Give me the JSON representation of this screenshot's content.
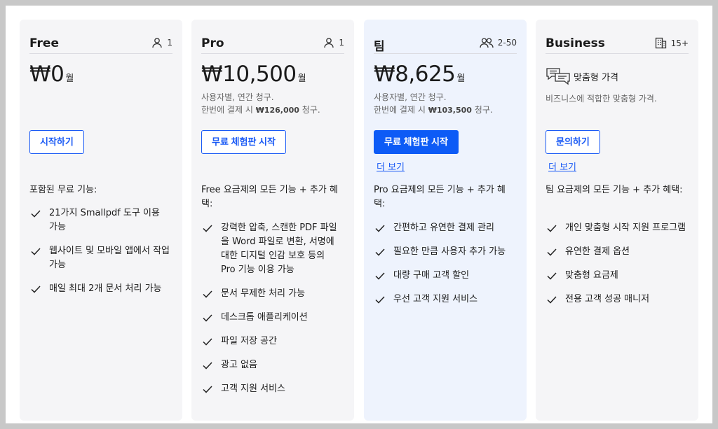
{
  "plans": [
    {
      "name": "Free",
      "users": "1",
      "price": "₩0",
      "per": "월",
      "cta": "시작하기",
      "features_title": "포함된 무료 기능:",
      "features": [
        "21가지 Smallpdf 도구 이용 가능",
        "웹사이트 및 모바일 앱에서 작업 가능",
        "매일 최대 2개 문서 처리 가능"
      ]
    },
    {
      "name": "Pro",
      "users": "1",
      "price": "₩10,500",
      "per": "월",
      "billing_line1": "사용자별, 연간 청구.",
      "billing_line2_pre": "한번에 결제 시",
      "billing_amount": "₩126,000",
      "billing_line2_post": "청구.",
      "cta": "무료 체험판 시작",
      "features_title": "Free 요금제의 모든 기능 + 추가 혜택:",
      "features": [
        "강력한 압축, 스캔한 PDF 파일을 Word 파일로 변환, 서명에 대한 디지털 인감 보호 등의 Pro 기능 이용 가능",
        "문서 무제한 처리 가능",
        "데스크톱 애플리케이션",
        "파일 저장 공간",
        "광고 없음",
        "고객 지원 서비스"
      ]
    },
    {
      "name": "팀",
      "users": "2-50",
      "price": "₩8,625",
      "per": "월",
      "billing_line1": "사용자별, 연간 청구.",
      "billing_line2_pre": "한번에 결제 시",
      "billing_amount": "₩103,500",
      "billing_line2_post": "청구.",
      "cta": "무료 체험판 시작",
      "more": "더 보기",
      "features_title": "Pro 요금제의 모든 기능 + 추가 혜택:",
      "features": [
        "간편하고 유연한 결제 관리",
        "필요한 만큼 사용자 추가 가능",
        "대량 구매 고객 할인",
        "우선 고객 지원 서비스"
      ]
    },
    {
      "name": "Business",
      "users": "15+",
      "custom_label": "맞춤형 가격",
      "custom_sub": "비즈니스에 적합한 맞춤형 가격.",
      "cta": "문의하기",
      "more": "더 보기",
      "features_title": "팀 요금제의 모든 기능 + 추가 혜택:",
      "features": [
        "개인 맞춤형 시작 지원 프로그램",
        "유연한 결제 옵션",
        "맞춤형 요금제",
        "전용 고객 성공 매니저"
      ]
    }
  ],
  "colors": {
    "accent": "#0d5bf6",
    "card": "#f5f5f7",
    "card_highlight": "#eef3fd"
  },
  "icons": {
    "single_user": "user-icon",
    "group": "users-icon",
    "building": "building-icon",
    "chat": "chat-icon",
    "check": "check-icon"
  }
}
